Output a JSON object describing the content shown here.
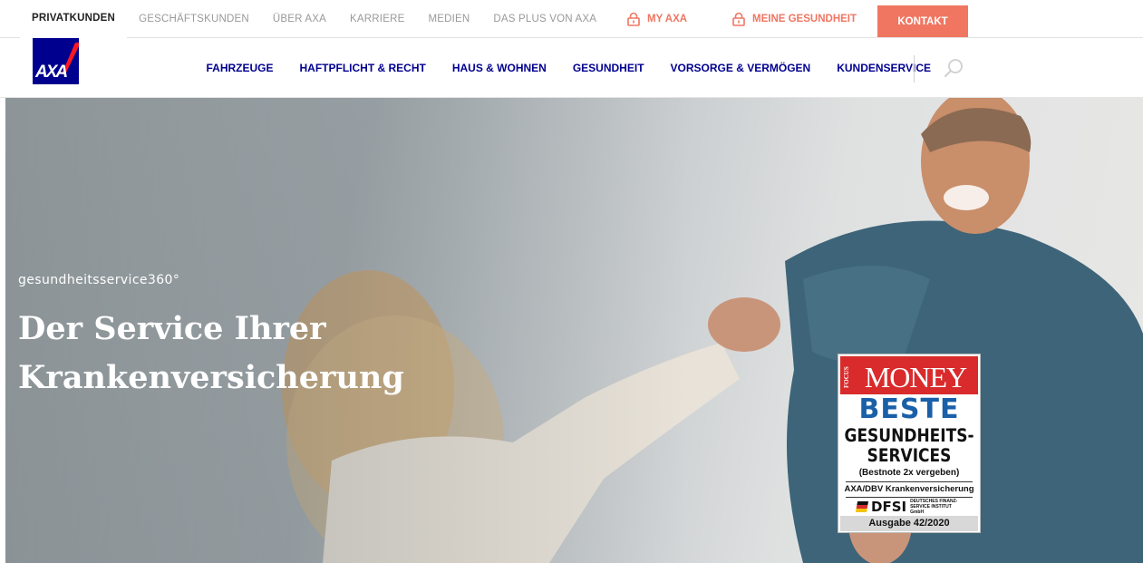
{
  "topnav": {
    "items": [
      {
        "label": "PRIVATKUNDEN"
      },
      {
        "label": "GESCHÄFTSKUNDEN"
      },
      {
        "label": "ÜBER AXA"
      },
      {
        "label": "KARRIERE"
      },
      {
        "label": "MEDIEN"
      },
      {
        "label": "DAS PLUS VON AXA"
      }
    ],
    "my_axa": "MY AXA",
    "meine_gesundheit": "MEINE GESUNDHEIT",
    "kontakt": "KONTAKT"
  },
  "logo": {
    "text": "AXA"
  },
  "mainnav": {
    "items": [
      {
        "label": "FAHRZEUGE"
      },
      {
        "label": "HAFTPFLICHT & RECHT"
      },
      {
        "label": "HAUS & WOHNEN"
      },
      {
        "label": "GESUNDHEIT"
      },
      {
        "label": "VORSORGE & VERMÖGEN"
      },
      {
        "label": "KUNDENSERVICE"
      }
    ]
  },
  "hero": {
    "subtitle": "gesundheitsservice360°",
    "title": "Der Service Ihrer Krankenversicherung"
  },
  "badge": {
    "focus": "FOCUS",
    "money": "MONEY",
    "beste": "BESTE",
    "line1": "GESUNDHEITS-",
    "line2": "SERVICES",
    "note": "(Bestnote 2x vergeben)",
    "insurer": "AXA/DBV Krankenversicherung",
    "dfsi": "DFSI",
    "dfsi_sub": "DEUTSCHES FINANZ-SERVICE INSTITUT GmbH",
    "issue": "Ausgabe 42/2020"
  },
  "colors": {
    "brand_blue": "#00008f",
    "accent_coral": "#f07662"
  },
  "icons": {
    "login": "lock-icon",
    "search": "search-icon"
  }
}
